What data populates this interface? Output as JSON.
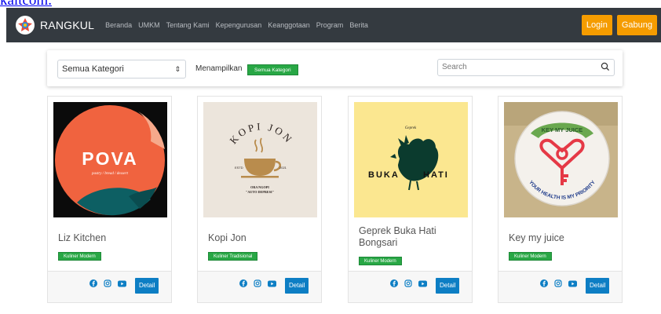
{
  "top_link": {
    "text": "kaltcom."
  },
  "navbar": {
    "brand": "RANGKUL",
    "links": [
      "Beranda",
      "UMKM",
      "Tentang Kami",
      "Kepengurusan",
      "Keanggotaan",
      "Program",
      "Berita"
    ],
    "login_label": "Login",
    "join_label": "Gabung",
    "background": "#343a40",
    "accent": "#f59c00"
  },
  "filter": {
    "category_select": "Semua Kategori",
    "showing_label": "Menampilkan",
    "showing_badge": "Semua Kategori",
    "search_placeholder": "Search"
  },
  "cards": [
    {
      "name": "Liz Kitchen",
      "category": "Kuliner Modern",
      "logo_text": "POVA",
      "logo_subtext": "pastry / bread / dessert",
      "detail_label": "Detail",
      "social": [
        "facebook-icon",
        "instagram-icon",
        "youtube-icon"
      ]
    },
    {
      "name": "Kopi Jon",
      "category": "Kuliner Tradisional",
      "logo_text": "KOPI JON",
      "logo_est": "ESTD",
      "logo_year": "2021",
      "logo_tagline_1": "ORA NGOPI",
      "logo_tagline_2": "\"AUTO DEPRESI\"",
      "detail_label": "Detail",
      "social": [
        "facebook-icon",
        "instagram-icon",
        "youtube-icon"
      ]
    },
    {
      "name": "Geprek Buka Hati Bongsari",
      "category": "Kuliner Modern",
      "logo_top": "Geprek",
      "logo_left": "BUKA",
      "logo_right": "HATI",
      "detail_label": "Detail",
      "social": [
        "facebook-icon",
        "instagram-icon",
        "youtube-icon"
      ]
    },
    {
      "name": "Key my juice",
      "category": "Kuliner Modern",
      "logo_top": "KEY MY JUICE",
      "logo_bottom": "YOUR HEALTH IS MY PRIORITY",
      "detail_label": "Detail",
      "social": [
        "facebook-icon",
        "instagram-icon",
        "youtube-icon"
      ]
    }
  ],
  "colors": {
    "badge_green": "#28a745",
    "detail_blue": "#0d7ec4",
    "social_blue": "#0d7ec4"
  }
}
